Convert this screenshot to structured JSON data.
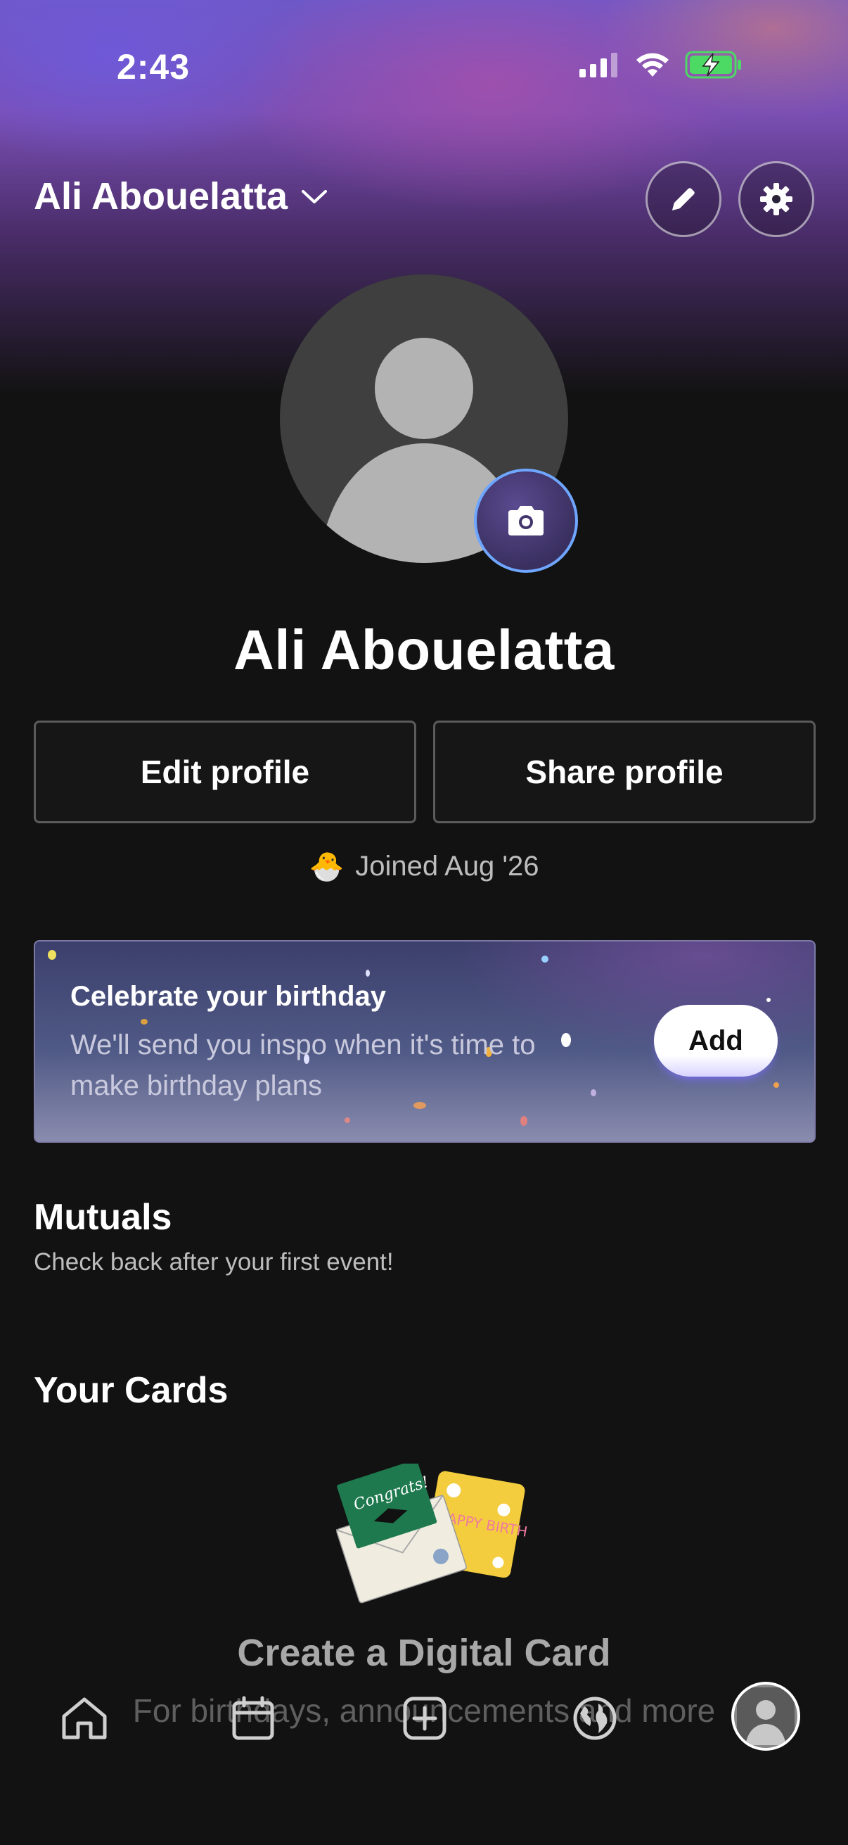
{
  "status_bar": {
    "time": "2:43",
    "icons": [
      "cellular-signal-icon",
      "wifi-icon",
      "battery-charging-icon"
    ]
  },
  "header": {
    "account_name": "Ali Abouelatta",
    "dropdown_icon": "chevron-down-icon",
    "edit_icon": "pencil-icon",
    "settings_icon": "gear-icon"
  },
  "profile": {
    "name": "Ali Abouelatta",
    "avatar_icon": "default-avatar-icon",
    "camera_icon": "camera-icon",
    "edit_label": "Edit profile",
    "share_label": "Share profile",
    "joined_emoji": "🐣",
    "joined_text": "Joined Aug '26"
  },
  "birthday_card": {
    "title": "Celebrate your birthday",
    "subtitle": "We'll send you inspo when it's time to make birthday plans",
    "button": "Add"
  },
  "mutuals": {
    "title": "Mutuals",
    "subtitle": "Check back after your first event!"
  },
  "cards": {
    "title": "Your Cards",
    "illustration_text_1": "Congrats!",
    "illustration_text_2": "HAPPY BIRTHDAY",
    "empty_title": "Create a Digital Card",
    "empty_subtitle": "For birthdays, announcements and more"
  },
  "bottom_nav": {
    "items": [
      "home-icon",
      "calendar-icon",
      "add-icon",
      "globe-icon",
      "profile-avatar-icon"
    ],
    "active": "profile-avatar-icon"
  },
  "colors": {
    "background": "#121212",
    "accent_ring": "#6fa6ff",
    "battery": "#4cd964"
  }
}
